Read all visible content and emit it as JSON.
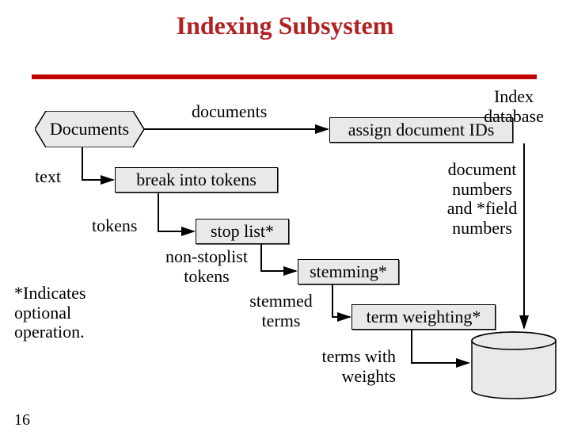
{
  "title": "Indexing Subsystem",
  "shapes": {
    "documents_hex": "Documents",
    "break_tokens": "break into tokens",
    "stop_list": "stop list*",
    "assign_ids": "assign document IDs",
    "stemming": "stemming*",
    "term_weighting": "term weighting*"
  },
  "labels": {
    "documents_flow": "documents",
    "text": "text",
    "tokens": "tokens",
    "non_stoplist_tokens": "non-stoplist\ntokens",
    "stemmed_terms": "stemmed\nterms",
    "terms_with_weights": "terms with\nweights",
    "doc_numbers_field": "document\nnumbers\nand *field\nnumbers",
    "footnote": "*Indicates\noptional\noperation.",
    "index_db": "Index\ndatabase"
  },
  "slide_number": "16"
}
